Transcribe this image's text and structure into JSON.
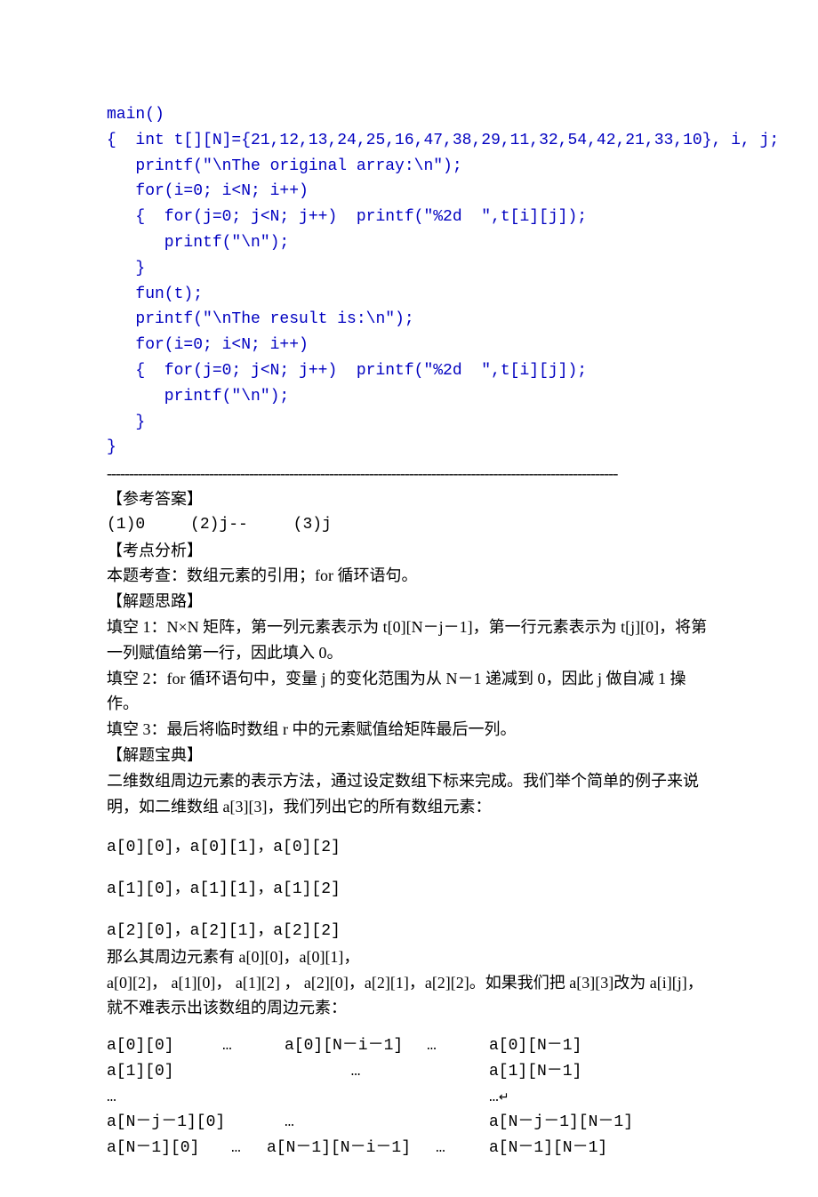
{
  "code": "main()\n{  int t[][N]={21,12,13,24,25,16,47,38,29,11,32,54,42,21,33,10}, i, j;\n   printf(\"\\nThe original array:\\n\");\n   for(i=0; i<N; i++)\n   {  for(j=0; j<N; j++)  printf(\"%2d  \",t[i][j]);\n      printf(\"\\n\");\n   }\n   fun(t);\n   printf(\"\\nThe result is:\\n\");\n   for(i=0; i<N; i++)\n   {  for(j=0; j<N; j++)  printf(\"%2d  \",t[i][j]);\n      printf(\"\\n\");\n   }\n}",
  "divider": "-------------------------------------------------------------------------------------------------------------------",
  "headings": {
    "answer": "【参考答案】",
    "analysis": "【考点分析】",
    "approach": "【解题思路】",
    "treasure": "【解题宝典】"
  },
  "answers": {
    "a1": "(1)0",
    "a2": "(2)j--",
    "a3": "(3)j"
  },
  "analysis_text": "本题考查：数组元素的引用；for 循环语句。",
  "blank1": "填空 1：N×N 矩阵，第一列元素表示为 t[0][N－j－1]，第一行元素表示为 t[j][0]，将第一列赋值给第一行，因此填入 0。",
  "blank2": "填空 2：for 循环语句中，变量 j 的变化范围为从 N－1 递减到 0，因此 j 做自减 1 操作。",
  "blank3": "填空 3：最后将临时数组 r 中的元素赋值给矩阵最后一列。",
  "para1": "二维数组周边元素的表示方法，通过设定数组下标来完成。我们举个简单的例子来说明，如二维数组 a[3][3]，我们列出它的所有数组元素：",
  "row_a0": "a[0][0]，a[0][1]，a[0][2]",
  "row_a1": "a[1][0]，a[1][1]，a[1][2]",
  "row_a2": "a[2][0]，a[2][1]，a[2][2]",
  "para2a": "那么其周边元素有 a[0][0]，a[0][1]，",
  "para2b": "a[0][2]， a[1][0]， a[1][2] ， a[2][0]，a[2][1]，a[2][2]。如果我们把 a[3][3]改为 a[i][j]，就不难表示出该数组的周边元素：",
  "matrix": {
    "r0": {
      "c0": "a[0][0]",
      "c1": "…",
      "c2": "a[0][N－i－1]",
      "c3": "…",
      "c4": "a[0][N－1]"
    },
    "r1": {
      "c0": "a[1][0]",
      "c1": "",
      "c2": "…",
      "c3": "",
      "c4": "a[1][N－1]"
    },
    "r2": {
      "c0": "…",
      "c1": "",
      "c2": "",
      "c3": "",
      "c4": "…",
      "ret": "↵"
    },
    "r3": {
      "c0": "a[N－j－1][0]",
      "c1": "",
      "c2": "…",
      "c3": "",
      "c4": "a[N－j－1][N－1]"
    },
    "r4": {
      "c0": "a[N－1][0]",
      "c1": "…",
      "c2": "a[N－1][N－i－1]",
      "c3": "…",
      "c4": "a[N－1][N－1]"
    }
  }
}
